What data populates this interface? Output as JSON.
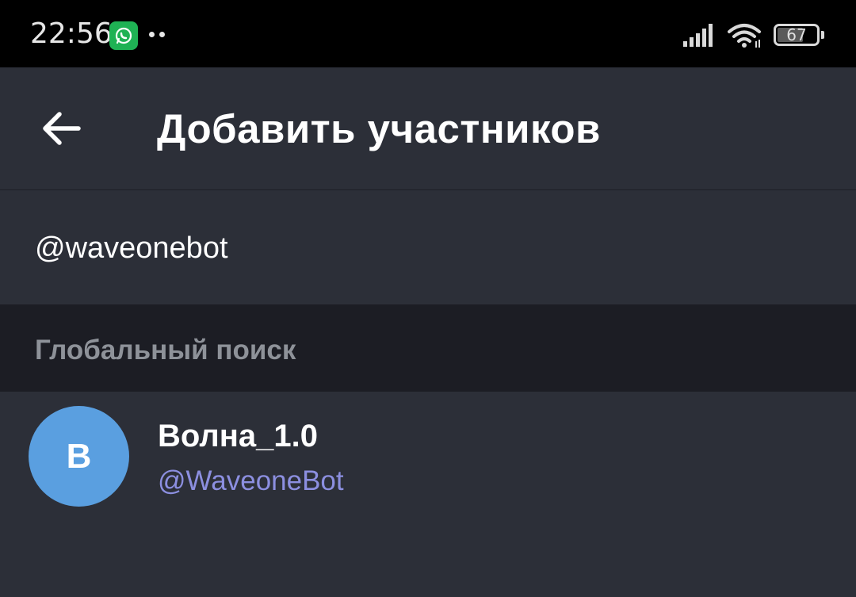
{
  "status_bar": {
    "time": "22:56",
    "notification_icon": "whatsapp-icon",
    "signal_icon": "signal-bars-icon",
    "wifi_icon": "wifi-icon",
    "battery_level": "67",
    "battery_percent": 67
  },
  "header": {
    "back_icon": "arrow-left-icon",
    "title": "Добавить участников"
  },
  "search": {
    "value": "@waveonebot",
    "placeholder": ""
  },
  "section": {
    "title": "Глобальный поиск"
  },
  "results": [
    {
      "avatar_letter": "B",
      "avatar_color": "#5a9fe0",
      "name": "Волна_1.0",
      "username": "@WaveoneBot"
    }
  ],
  "colors": {
    "background": "#232530",
    "header": "#2c2f38",
    "section_bg": "#1c1d24",
    "username": "#8c8fe0",
    "section_title": "#8e9299"
  }
}
